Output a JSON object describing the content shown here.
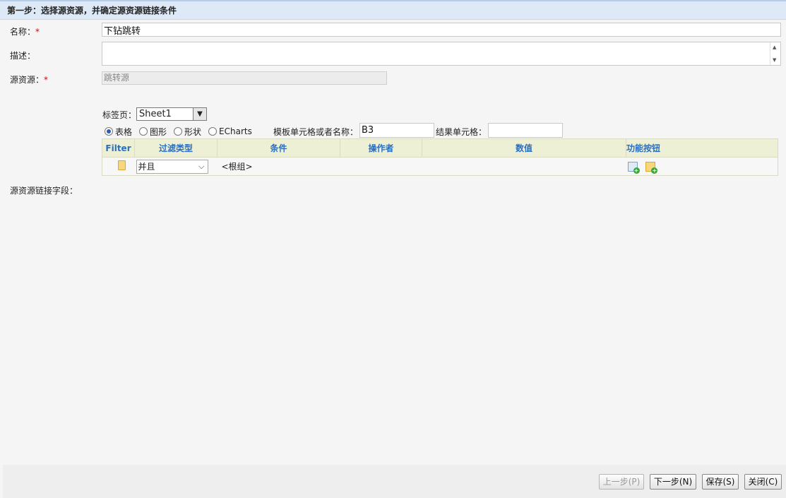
{
  "header": {
    "title": "第一步：选择源资源，并确定源资源链接条件"
  },
  "form": {
    "name_label": "名称：",
    "required_mark": "*",
    "name_value": "下钻跳转",
    "desc_label": "描述：",
    "desc_value": "",
    "source_label": "源资源：",
    "source_value": "跳转源",
    "sheet_label": "标签页：",
    "sheet_value": "Sheet1",
    "radios": [
      {
        "label": "表格",
        "checked": true
      },
      {
        "label": "图形",
        "checked": false
      },
      {
        "label": "形状",
        "checked": false
      },
      {
        "label": "ECharts",
        "checked": false
      }
    ],
    "template_label": "模板单元格或者名称：",
    "template_value": "B3",
    "result_label": "结果单元格：",
    "result_value": ""
  },
  "table": {
    "headers": [
      "Filter",
      "过滤类型",
      "条件",
      "操作者",
      "数值",
      "功能按钮"
    ],
    "row": {
      "logic": "并且",
      "condition": "<根组>"
    }
  },
  "link_label": "源资源链接字段：",
  "buttons": {
    "prev": "上一步(P)",
    "next": "下一步(N)",
    "save": "保存(S)",
    "close": "关闭(C)"
  }
}
